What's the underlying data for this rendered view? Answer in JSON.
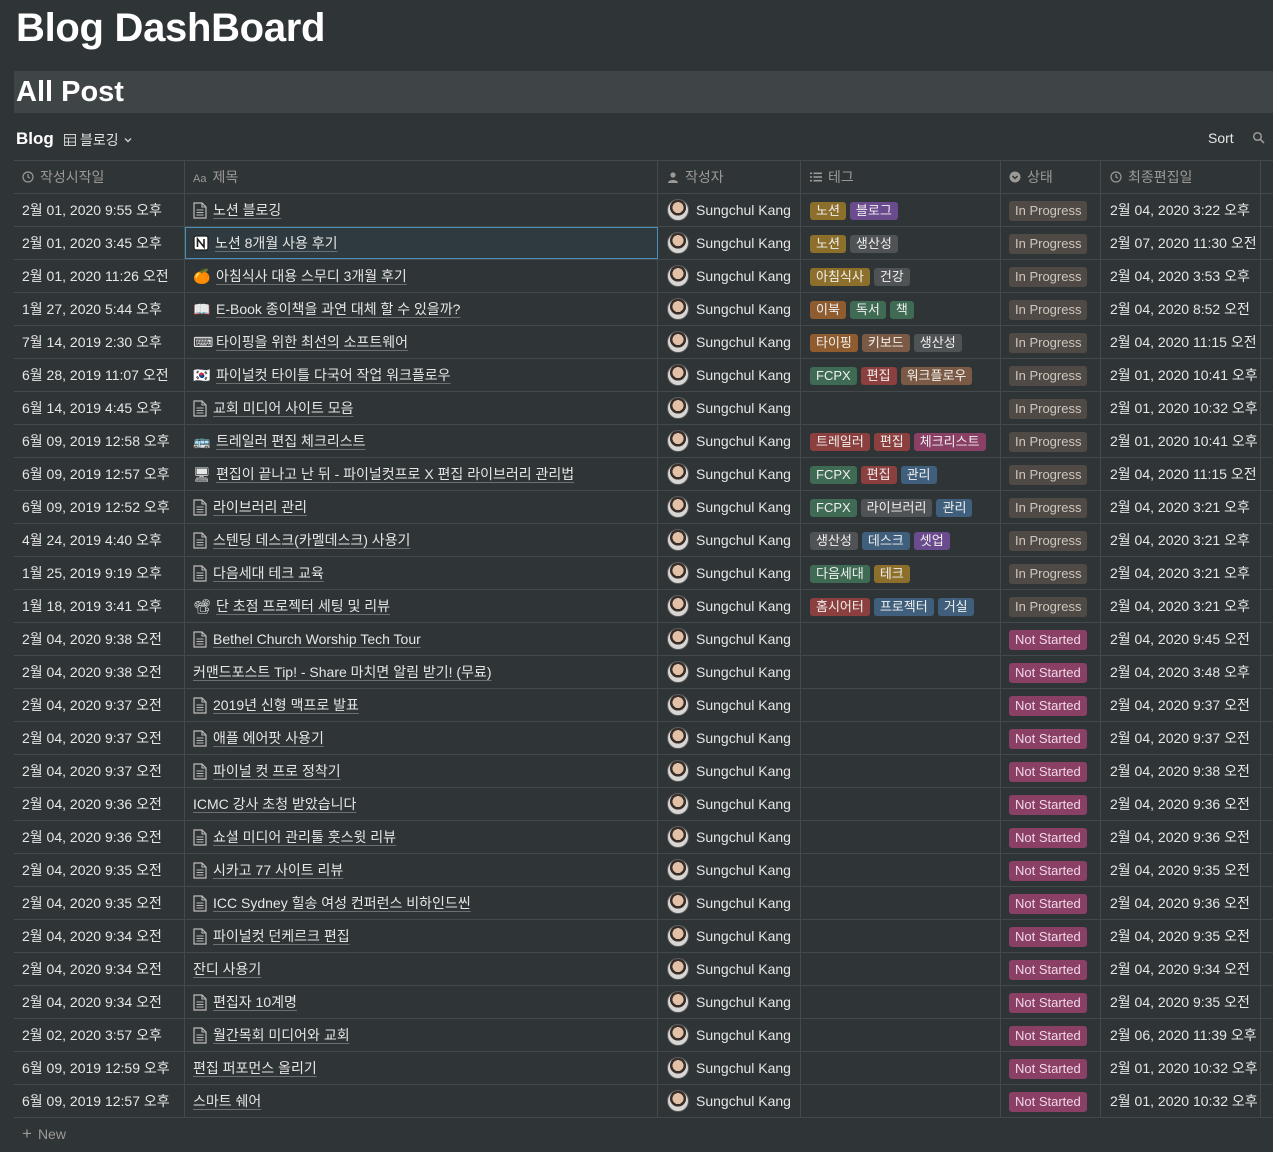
{
  "page": {
    "title": "Blog DashBoard"
  },
  "section": {
    "title": "All Post"
  },
  "view": {
    "name": "Blog",
    "selected_view": "블로깅",
    "sort_label": "Sort"
  },
  "columns": [
    {
      "label": "작성시작일",
      "icon": "clock-icon"
    },
    {
      "label": "제목",
      "icon": "text-aa-icon"
    },
    {
      "label": "작성자",
      "icon": "person-icon"
    },
    {
      "label": "테그",
      "icon": "list-icon"
    },
    {
      "label": "상태",
      "icon": "select-icon"
    },
    {
      "label": "최종편집일",
      "icon": "clock-icon"
    }
  ],
  "tag_colors": {
    "yellow": "#8c6f2b",
    "purple": "#6a4b8e",
    "gray": "#4f5356",
    "brown": "#7b5a45",
    "orange": "#8f5c2f",
    "green": "#3f6b55",
    "red": "#8b3f3f",
    "pink": "#8a3f64",
    "blue": "#3f5f7c"
  },
  "status_colors": {
    "In Progress": {
      "bg": "#4f4a45",
      "fg": "#cfc7bd"
    },
    "Not Started": {
      "bg": "#8a3f64",
      "fg": "#f0d8e5"
    }
  },
  "rows": [
    {
      "start": "2월 01, 2020 9:55 오후",
      "icon": "doc",
      "title": "노션 블로깅",
      "author": "Sungchul Kang",
      "tags": [
        [
          "노션",
          "yellow"
        ],
        [
          "블로그",
          "purple"
        ]
      ],
      "status": "In Progress",
      "edited": "2월 04, 2020 3:22 오후"
    },
    {
      "start": "2월 01, 2020 3:45 오후",
      "icon": "notion",
      "title": "노션 8개월 사용 후기",
      "author": "Sungchul Kang",
      "tags": [
        [
          "노션",
          "yellow"
        ],
        [
          "생산성",
          "gray"
        ]
      ],
      "status": "In Progress",
      "edited": "2월 07, 2020 11:30 오전",
      "selected": true
    },
    {
      "start": "2월 01, 2020 11:26 오전",
      "icon": "🍊",
      "title": "아침식사 대용 스무디 3개월 후기",
      "author": "Sungchul Kang",
      "tags": [
        [
          "아침식사",
          "yellow"
        ],
        [
          "건강",
          "gray"
        ]
      ],
      "status": "In Progress",
      "edited": "2월 04, 2020 3:53 오후"
    },
    {
      "start": "1월 27, 2020 5:44 오후",
      "icon": "📖",
      "title": "E-Book 종이책을 과연 대체 할 수 있을까?",
      "author": "Sungchul Kang",
      "tags": [
        [
          "이북",
          "orange"
        ],
        [
          "독서",
          "green"
        ],
        [
          "책",
          "green"
        ]
      ],
      "status": "In Progress",
      "edited": "2월 04, 2020 8:52 오전"
    },
    {
      "start": "7월 14, 2019 2:30 오후",
      "icon": "⌨",
      "title": "타이핑을 위한 최선의 소프트웨어",
      "author": "Sungchul Kang",
      "tags": [
        [
          "타이핑",
          "orange"
        ],
        [
          "키보드",
          "brown"
        ],
        [
          "생산성",
          "gray"
        ]
      ],
      "status": "In Progress",
      "edited": "2월 04, 2020 11:15 오전"
    },
    {
      "start": "6월 28, 2019 11:07 오전",
      "icon": "🇰🇷",
      "title": "파이널컷 타이틀 다국어 작업 워크플로우",
      "author": "Sungchul Kang",
      "tags": [
        [
          "FCPX",
          "green"
        ],
        [
          "편집",
          "red"
        ],
        [
          "워크플로우",
          "brown"
        ]
      ],
      "status": "In Progress",
      "edited": "2월 01, 2020 10:41 오후"
    },
    {
      "start": "6월 14, 2019 4:45 오후",
      "icon": "doc",
      "title": "교회 미디어 사이트 모음",
      "author": "Sungchul Kang",
      "tags": [],
      "status": "In Progress",
      "edited": "2월 01, 2020 10:32 오후"
    },
    {
      "start": "6월 09, 2019 12:58 오후",
      "icon": "🚌",
      "title": "트레일러 편집 체크리스트",
      "author": "Sungchul Kang",
      "tags": [
        [
          "트레일러",
          "red"
        ],
        [
          "편집",
          "red"
        ],
        [
          "체크리스트",
          "pink"
        ]
      ],
      "status": "In Progress",
      "edited": "2월 01, 2020 10:41 오후"
    },
    {
      "start": "6월 09, 2019 12:57 오후",
      "icon": "🖥",
      "title": "편집이 끝나고 난 뒤 - 파이널컷프로 X 편집 라이브러리 관리법",
      "author": "Sungchul Kang",
      "tags": [
        [
          "FCPX",
          "green"
        ],
        [
          "편집",
          "red"
        ],
        [
          "관리",
          "blue"
        ]
      ],
      "status": "In Progress",
      "edited": "2월 04, 2020 11:15 오전"
    },
    {
      "start": "6월 09, 2019 12:52 오후",
      "icon": "doc",
      "title": "라이브러리 관리",
      "author": "Sungchul Kang",
      "tags": [
        [
          "FCPX",
          "green"
        ],
        [
          "라이브러리",
          "gray"
        ],
        [
          "관리",
          "blue"
        ]
      ],
      "status": "In Progress",
      "edited": "2월 04, 2020 3:21 오후"
    },
    {
      "start": "4월 24, 2019 4:40 오후",
      "icon": "doc",
      "title": "스텐딩 데스크(카멜데스크) 사용기",
      "author": "Sungchul Kang",
      "tags": [
        [
          "생산성",
          "gray"
        ],
        [
          "데스크",
          "blue"
        ],
        [
          "셋업",
          "purple"
        ]
      ],
      "status": "In Progress",
      "edited": "2월 04, 2020 3:21 오후"
    },
    {
      "start": "1월 25, 2019 9:19 오후",
      "icon": "doc",
      "title": "다음세대 테크 교육",
      "author": "Sungchul Kang",
      "tags": [
        [
          "다음세대",
          "green"
        ],
        [
          "테크",
          "yellow"
        ]
      ],
      "status": "In Progress",
      "edited": "2월 04, 2020 3:21 오후"
    },
    {
      "start": "1월 18, 2019 3:41 오후",
      "icon": "📽",
      "title": "단 초점 프로젝터 세팅 및 리뷰",
      "author": "Sungchul Kang",
      "tags": [
        [
          "홈시어터",
          "red"
        ],
        [
          "프로젝터",
          "blue"
        ],
        [
          "거실",
          "blue"
        ]
      ],
      "status": "In Progress",
      "edited": "2월 04, 2020 3:21 오후"
    },
    {
      "start": "2월 04, 2020 9:38 오전",
      "icon": "doc",
      "title": "Bethel Church Worship Tech Tour",
      "author": "Sungchul Kang",
      "tags": [],
      "status": "Not Started",
      "edited": "2월 04, 2020 9:45 오전"
    },
    {
      "start": "2월 04, 2020 9:38 오전",
      "icon": "",
      "title": "커맨드포스트 Tip! - Share 마치면 알림 받기! (무료)",
      "author": "Sungchul Kang",
      "tags": [],
      "status": "Not Started",
      "edited": "2월 04, 2020 3:48 오후"
    },
    {
      "start": "2월 04, 2020 9:37 오전",
      "icon": "doc",
      "title": "2019년 신형 맥프로 발표",
      "author": "Sungchul Kang",
      "tags": [],
      "status": "Not Started",
      "edited": "2월 04, 2020 9:37 오전"
    },
    {
      "start": "2월 04, 2020 9:37 오전",
      "icon": "doc",
      "title": "애플 에어팟 사용기",
      "author": "Sungchul Kang",
      "tags": [],
      "status": "Not Started",
      "edited": "2월 04, 2020 9:37 오전"
    },
    {
      "start": "2월 04, 2020 9:37 오전",
      "icon": "doc",
      "title": "파이널 컷 프로 정착기",
      "author": "Sungchul Kang",
      "tags": [],
      "status": "Not Started",
      "edited": "2월 04, 2020 9:38 오전"
    },
    {
      "start": "2월 04, 2020 9:36 오전",
      "icon": "",
      "title": "ICMC 강사 초청 받았습니다",
      "author": "Sungchul Kang",
      "tags": [],
      "status": "Not Started",
      "edited": "2월 04, 2020 9:36 오전"
    },
    {
      "start": "2월 04, 2020 9:36 오전",
      "icon": "doc",
      "title": "쇼셜 미디어 관리툴 훗스윗 리뷰",
      "author": "Sungchul Kang",
      "tags": [],
      "status": "Not Started",
      "edited": "2월 04, 2020 9:36 오전"
    },
    {
      "start": "2월 04, 2020 9:35 오전",
      "icon": "doc",
      "title": "시카고 77 사이트 리뷰",
      "author": "Sungchul Kang",
      "tags": [],
      "status": "Not Started",
      "edited": "2월 04, 2020 9:35 오전"
    },
    {
      "start": "2월 04, 2020 9:35 오전",
      "icon": "doc",
      "title": "ICC Sydney 힐송 여성 컨퍼런스 비하인드씬",
      "author": "Sungchul Kang",
      "tags": [],
      "status": "Not Started",
      "edited": "2월 04, 2020 9:36 오전"
    },
    {
      "start": "2월 04, 2020 9:34 오전",
      "icon": "doc",
      "title": "파이널컷 던케르크 편집",
      "author": "Sungchul Kang",
      "tags": [],
      "status": "Not Started",
      "edited": "2월 04, 2020 9:35 오전"
    },
    {
      "start": "2월 04, 2020 9:34 오전",
      "icon": "",
      "title": "잔디 사용기",
      "author": "Sungchul Kang",
      "tags": [],
      "status": "Not Started",
      "edited": "2월 04, 2020 9:34 오전"
    },
    {
      "start": "2월 04, 2020 9:34 오전",
      "icon": "doc",
      "title": "편집자 10계명",
      "author": "Sungchul Kang",
      "tags": [],
      "status": "Not Started",
      "edited": "2월 04, 2020 9:35 오전"
    },
    {
      "start": "2월 02, 2020 3:57 오후",
      "icon": "doc",
      "title": "월간목회 미디어와 교회",
      "author": "Sungchul Kang",
      "tags": [],
      "status": "Not Started",
      "edited": "2월 06, 2020 11:39 오후"
    },
    {
      "start": "6월 09, 2019 12:59 오후",
      "icon": "",
      "title": "편집 퍼포먼스 올리기",
      "author": "Sungchul Kang",
      "tags": [],
      "status": "Not Started",
      "edited": "2월 01, 2020 10:32 오후"
    },
    {
      "start": "6월 09, 2019 12:57 오후",
      "icon": "",
      "title": "스마트 쉐어",
      "author": "Sungchul Kang",
      "tags": [],
      "status": "Not Started",
      "edited": "2월 01, 2020 10:32 오후"
    }
  ],
  "footer": {
    "new_label": "New"
  }
}
